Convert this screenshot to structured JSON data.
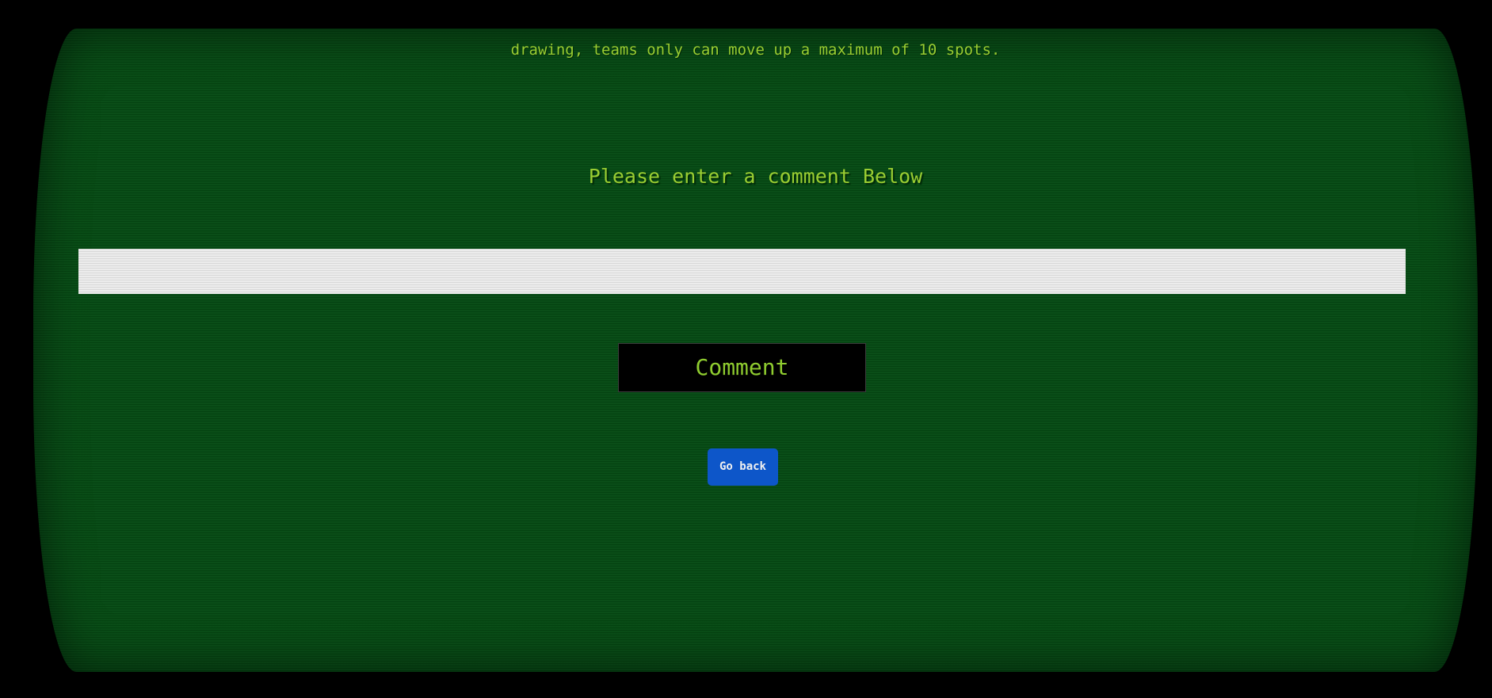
{
  "intro": {
    "text": "drawing, teams only can move up a maximum of 10 spots."
  },
  "comment_form": {
    "prompt": "Please enter a comment Below",
    "input_value": "",
    "input_placeholder": "",
    "submit_label": "Comment"
  },
  "navigation": {
    "go_back_label": "Go back"
  },
  "colors": {
    "screen_background": "#054a13",
    "text_green": "#9acd32",
    "go_back_blue": "#0d56c9",
    "input_background": "#e0e0e0"
  }
}
